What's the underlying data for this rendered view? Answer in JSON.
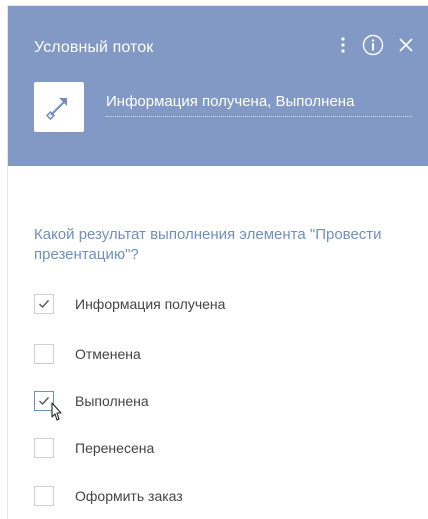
{
  "header": {
    "title": "Условный поток",
    "icons": [
      "kebab-menu-icon",
      "info-icon",
      "close-icon"
    ],
    "background_color": "#8199c4"
  },
  "element": {
    "icon": "flow-arrow-icon",
    "name": "Информация получена, Выполнена"
  },
  "question": "Какой результат выполнения элемента \"Провести презентацию\"?",
  "options": [
    {
      "label": "Информация получена",
      "checked": true
    },
    {
      "label": "Отменена",
      "checked": false
    },
    {
      "label": "Выполнена",
      "checked": true
    },
    {
      "label": "Перенесена",
      "checked": false
    },
    {
      "label": "Оформить заказ",
      "checked": false
    }
  ],
  "colors": {
    "accent": "#6f8fbf",
    "text": "#444444"
  }
}
